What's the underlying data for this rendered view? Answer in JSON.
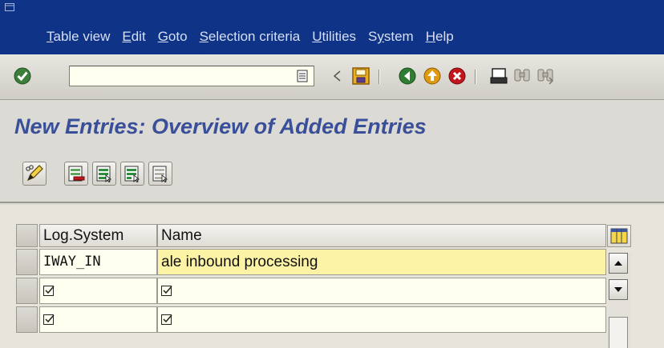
{
  "menubar": {
    "items": [
      {
        "label": "Table view",
        "mnemonic": "T"
      },
      {
        "label": "Edit",
        "mnemonic": "E"
      },
      {
        "label": "Goto",
        "mnemonic": "G"
      },
      {
        "label": "Selection criteria",
        "mnemonic": "S"
      },
      {
        "label": "Utilities",
        "mnemonic": "U"
      },
      {
        "label": "System",
        "mnemonic": "y"
      },
      {
        "label": "Help",
        "mnemonic": "H"
      }
    ]
  },
  "toolbar": {
    "command_value": "",
    "icons": [
      "enter-icon",
      "command-history-icon",
      "back-arrow-icon",
      "save-icon",
      "back-icon",
      "exit-icon",
      "cancel-icon",
      "print-icon",
      "find-icon",
      "find-next-icon"
    ]
  },
  "title": "New Entries: Overview of Added Entries",
  "app_toolbar": {
    "icons": [
      "change-display-icon",
      "delete-icon",
      "select-all-icon",
      "select-block-icon",
      "deselect-all-icon"
    ]
  },
  "table": {
    "headers": [
      "Log.System",
      "Name"
    ],
    "rows": [
      {
        "log_system": "IWAY_IN",
        "name": "ale inbound processing",
        "empty": false
      },
      {
        "log_system": "",
        "name": "",
        "empty": true
      },
      {
        "log_system": "",
        "name": "",
        "empty": true
      }
    ]
  },
  "colors": {
    "menubar_bg": "#0f3487",
    "title": "#3a4f99",
    "input_bg": "#fffff0",
    "highlight_bg": "#fdf3a7"
  }
}
